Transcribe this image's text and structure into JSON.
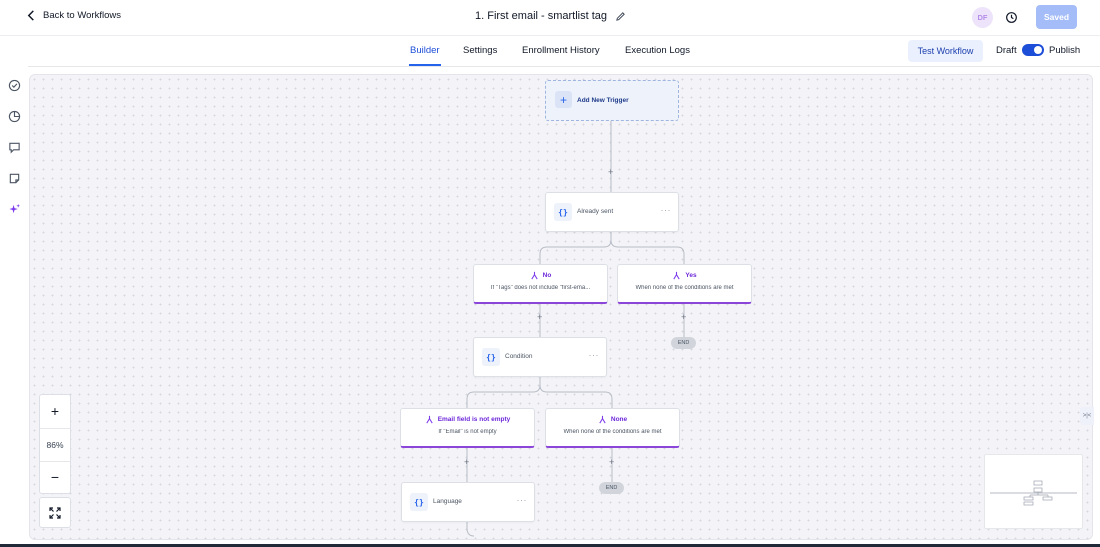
{
  "header": {
    "back_label": "Back to Workflows",
    "workflow_title": "1. First email - smartlist tag",
    "avatar_initials": "DF",
    "saved_label": "Saved"
  },
  "tabs": [
    {
      "label": "Builder",
      "active": true
    },
    {
      "label": "Settings",
      "active": false
    },
    {
      "label": "Enrollment History",
      "active": false
    },
    {
      "label": "Execution Logs",
      "active": false
    }
  ],
  "actions": {
    "test_label": "Test Workflow",
    "draft_label": "Draft",
    "publish_label": "Publish",
    "publish_enabled": true
  },
  "sidebar": {
    "icons": [
      "check-circle-icon",
      "pie-chart-icon",
      "comment-icon",
      "note-icon",
      "sparkle-icon"
    ]
  },
  "canvas": {
    "trigger_label": "Add New Trigger",
    "node_already_sent": "Already sent",
    "branch_no_title": "No",
    "branch_no_sub": "If \"Tags\" does not include \"first-ema...",
    "branch_yes_title": "Yes",
    "branch_yes_sub": "When none of the conditions are met",
    "node_condition": "Condition",
    "branch_email_title": "Email field is not empty",
    "branch_email_sub": "If \"Email\" is not empty",
    "branch_none_title": "None",
    "branch_none_sub": "When none of the conditions are met",
    "node_language": "Language",
    "end_label": "END",
    "node_icon_text": "{}",
    "plus_symbol": "+",
    "more_dots": "···"
  },
  "zoom": {
    "zoom_in": "+",
    "level": "86%",
    "zoom_out": "−"
  },
  "colors": {
    "accent_blue": "#2563eb",
    "branch_purple": "#8b45d8",
    "saved_button": "#a4bcf7"
  }
}
